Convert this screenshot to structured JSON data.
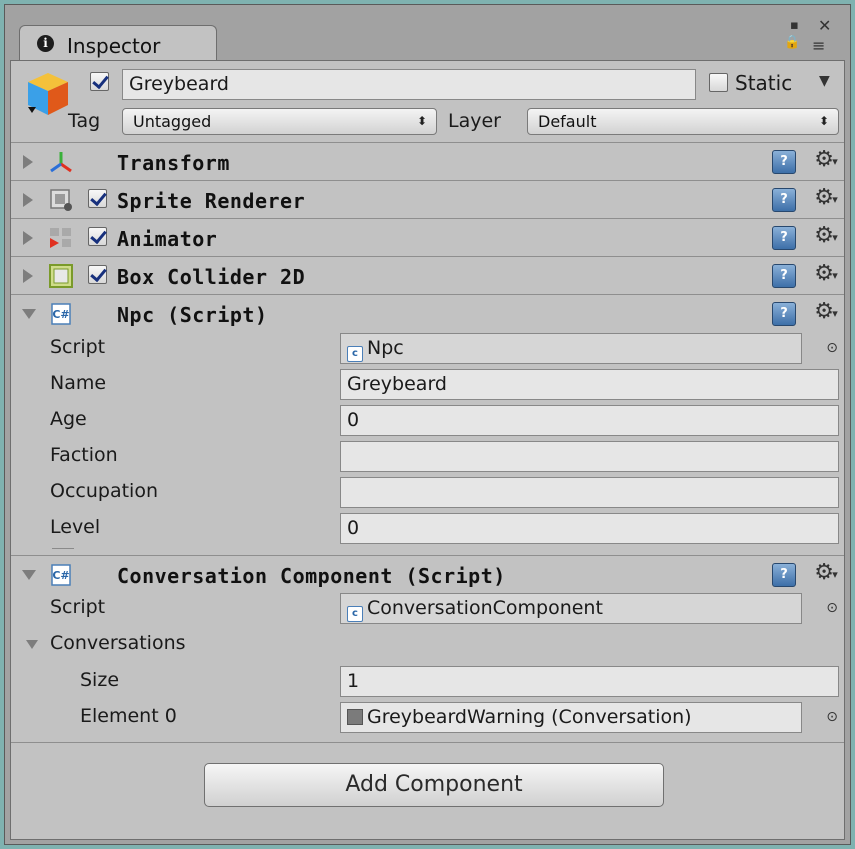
{
  "window": {
    "tab_label": "Inspector",
    "info_glyph": "i",
    "controls": {
      "close": "✕",
      "maximize": "▪",
      "lock": "🔒",
      "menu": "≡"
    }
  },
  "gameobject": {
    "active": true,
    "name": "Greybeard",
    "static_label": "Static",
    "static_checked": false,
    "tag_label": "Tag",
    "tag_value": "Untagged",
    "layer_label": "Layer",
    "layer_value": "Default"
  },
  "components": [
    {
      "title": "Transform",
      "expanded": false,
      "has_checkbox": false,
      "icon": "transform-axes-icon"
    },
    {
      "title": "Sprite Renderer",
      "expanded": false,
      "has_checkbox": true,
      "enabled": true,
      "icon": "sprite-renderer-icon"
    },
    {
      "title": "Animator",
      "expanded": false,
      "has_checkbox": true,
      "enabled": true,
      "icon": "animator-icon"
    },
    {
      "title": "Box Collider 2D",
      "expanded": false,
      "has_checkbox": true,
      "enabled": true,
      "icon": "box-collider-icon"
    },
    {
      "title": "Npc (Script)",
      "expanded": true,
      "has_checkbox": false,
      "icon": "script-icon"
    },
    {
      "title": "Conversation Component (Script)",
      "expanded": true,
      "has_checkbox": false,
      "icon": "script-icon"
    }
  ],
  "npc_fields": {
    "script_label": "Script",
    "script_value": "Npc",
    "name_label": "Name",
    "name_value": "Greybeard",
    "age_label": "Age",
    "age_value": "0",
    "faction_label": "Faction",
    "faction_value": "",
    "occupation_label": "Occupation",
    "occupation_value": "",
    "level_label": "Level",
    "level_value": "0"
  },
  "conversation_fields": {
    "script_label": "Script",
    "script_value": "ConversationComponent",
    "conversations_label": "Conversations",
    "size_label": "Size",
    "size_value": "1",
    "element0_label": "Element 0",
    "element0_value": "GreybeardWarning (Conversation)"
  },
  "add_component_label": "Add Component",
  "colors": {
    "background": "#7fb2b0",
    "panel": "#c2c2c2",
    "field": "#e6e6e6",
    "checkmark": "#17307d",
    "help_icon": "#3d6fa8"
  }
}
